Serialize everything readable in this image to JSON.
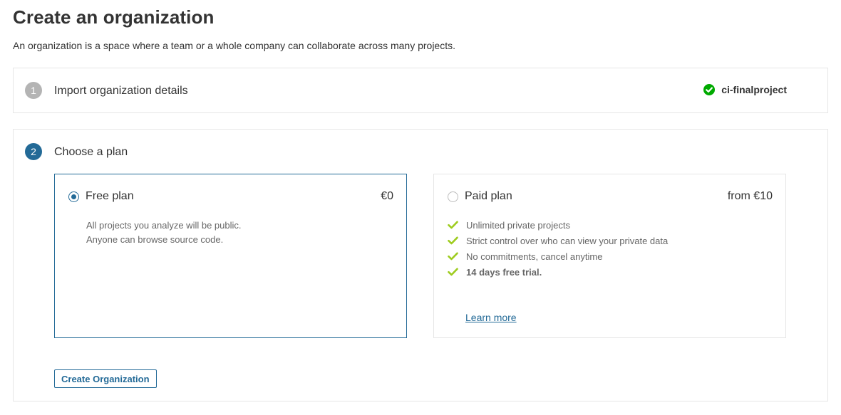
{
  "page": {
    "title": "Create an organization",
    "description": "An organization is a space where a team or a whole company can collaborate across many projects."
  },
  "step1": {
    "number": "1",
    "title": "Import organization details",
    "status_icon": "check-circle-icon",
    "status_value": "ci-finalproject",
    "status_color": "#00aa00"
  },
  "step2": {
    "number": "2",
    "title": "Choose a plan",
    "accent_color": "#236a97",
    "plans": [
      {
        "name": "Free plan",
        "price": "€0",
        "selected": true,
        "description": [
          "All projects you analyze will be public.",
          "Anyone can browse source code."
        ]
      },
      {
        "name": "Paid plan",
        "price": "from €10",
        "selected": false,
        "features": [
          "Unlimited private projects",
          "Strict control over who can view your private data",
          "No commitments, cancel anytime",
          "14 days free trial."
        ],
        "feature_icon": "checkmark-icon",
        "feature_icon_color": "#9ecc1f",
        "link_label": "Learn more"
      }
    ],
    "submit_label": "Create Organization"
  }
}
